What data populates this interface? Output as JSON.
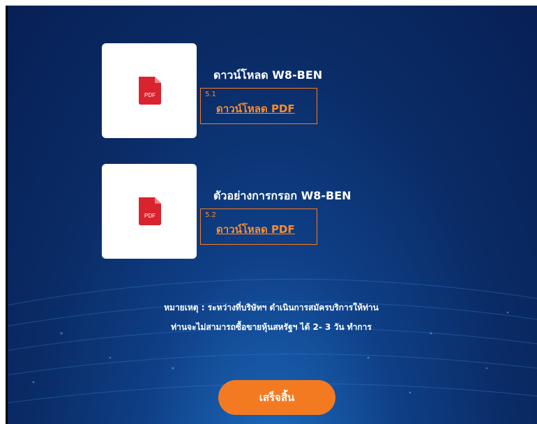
{
  "colors": {
    "accent": "#f47a22",
    "link": "#ff8c2a",
    "background": "#0a2b65",
    "pdf_red": "#d9232e"
  },
  "downloads": [
    {
      "icon": "pdf-file-icon",
      "pdf_label": "PDF",
      "title": "ดาวน์โหลด W8-BEN",
      "marker": "5.1",
      "link": "ดาวน์โหลด PDF"
    },
    {
      "icon": "pdf-file-icon",
      "pdf_label": "PDF",
      "title": "ตัวอย่างการกรอก W8-BEN",
      "marker": "5.2",
      "link": "ดาวน์โหลด PDF"
    }
  ],
  "note": {
    "line1": "หมายเหตุ : ระหว่างที่บริษัทฯ ดำเนินการสมัครบริการให้ท่าน",
    "line2": "ท่านจะไม่สามารถซื้อขายหุ้นสหรัฐฯ ได้ 2- 3 วัน ทำการ"
  },
  "done_button": "เสร็จสิ้น"
}
